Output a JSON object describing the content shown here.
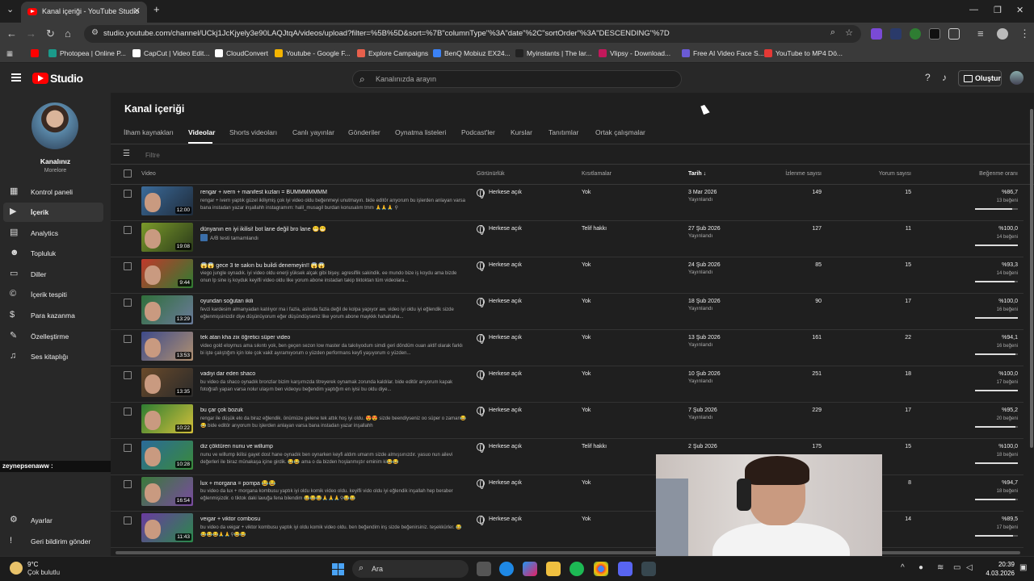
{
  "browser": {
    "tab_title": "Kanal içeriği - YouTube Studio",
    "url": "studio.youtube.com/channel/UCkj1JcKjyely3e90LAQJtqA/videos/upload?filter=%5B%5D&sort=%7B\"columnType\"%3A\"date\"%2C\"sortOrder\"%3A\"DESCENDING\"%7D",
    "bookmarks": [
      {
        "label": "",
        "color": "#ff0000"
      },
      {
        "label": "Photopea | Online P...",
        "color": "#1b9a8a"
      },
      {
        "label": "CapCut | Video Edit...",
        "color": "#ffffff"
      },
      {
        "label": "CloudConvert",
        "color": "#ffffff"
      },
      {
        "label": "Youtube - Google F...",
        "color": "#f4b400"
      },
      {
        "label": "Explore Campaigns",
        "color": "#e8604c"
      },
      {
        "label": "BenQ Mobiuz EX24...",
        "color": "#3b82f6"
      },
      {
        "label": "Myinstants | The lar...",
        "color": "#222222"
      },
      {
        "label": "Vlipsy - Download...",
        "color": "#c2185b"
      },
      {
        "label": "Free AI Video Face S...",
        "color": "#6b5bd6"
      },
      {
        "label": "YouTube to MP4 Dö...",
        "color": "#e53935"
      }
    ]
  },
  "header": {
    "logo": "Studio",
    "search_placeholder": "Kanalınızda arayın",
    "create_label": "Oluştur"
  },
  "sidebar": {
    "channel_name": "Kanalınız",
    "channel_sub": "Morelore",
    "items": [
      {
        "label": "Kontrol paneli",
        "icon": "▦"
      },
      {
        "label": "İçerik",
        "icon": "▶"
      },
      {
        "label": "Analytics",
        "icon": "▤"
      },
      {
        "label": "Topluluk",
        "icon": "☻"
      },
      {
        "label": "Diller",
        "icon": "▭"
      },
      {
        "label": "İçerik tespiti",
        "icon": "©"
      },
      {
        "label": "Para kazanma",
        "icon": "$"
      },
      {
        "label": "Özelleştirme",
        "icon": "✎"
      },
      {
        "label": "Ses kitaplığı",
        "icon": "♫"
      }
    ],
    "bottom": [
      {
        "label": "Ayarlar",
        "icon": "⚙"
      },
      {
        "label": "Geri bildirim gönder",
        "icon": "!"
      }
    ],
    "overlay_user": "zeynepsenaww :"
  },
  "main": {
    "title": "Kanal içeriği",
    "tabs": [
      "İlham kaynakları",
      "Videolar",
      "Shorts videoları",
      "Canlı yayınlar",
      "Gönderiler",
      "Oynatma listeleri",
      "Podcast'ler",
      "Kurslar",
      "Tanıtımlar",
      "Ortak çalışmalar"
    ],
    "filter_placeholder": "Filtre",
    "columns": {
      "video": "Video",
      "visibility": "Görünürlük",
      "restrictions": "Kısıtlamalar",
      "date": "Tarih",
      "views": "İzlenme sayısı",
      "comments": "Yorum sayısı",
      "likes": "Beğenme oranı"
    },
    "rows": [
      {
        "title": "rengar + ivern + manifest kızları = BUMMMMMMM",
        "desc": "rengar + ivern yaptık güzel ikiliymiş çok iyi video oldu beğenmeyi unutmayın. bide editör arıyorum bu işlerden anlayan varsa bana instadan yazar inşallahh instagramım: halil_musagil burdan konusalım tmm 🙏🙏🙏 ⚲",
        "duration": "12:00",
        "visibility": "Herkese açık",
        "restriction": "Yok",
        "date": "3 Mar 2026",
        "status": "Yayınlandı",
        "views": "149",
        "comments": "15",
        "like_pct": "%86,7",
        "like_count": "13 beğeni",
        "like_ratio": 0.867,
        "t1": "#3b6b9a",
        "t2": "#1f2b3a"
      },
      {
        "title": "dünyanın en iyi ikilisi! bot lane değil bro lane 😁😁",
        "desc": "",
        "sub": "A/B testi tamamlandı",
        "duration": "19:08",
        "visibility": "Herkese açık",
        "restriction": "Telif hakkı",
        "date": "27 Şub 2026",
        "status": "Yayınlandı",
        "views": "127",
        "comments": "11",
        "like_pct": "%100,0",
        "like_count": "14 beğeni",
        "like_ratio": 1.0,
        "t1": "#7b9a2a",
        "t2": "#2a3a1a"
      },
      {
        "title": "😱😱 gece 3 te sakın bu buildi denemeyin!! 😱😱",
        "desc": "viego jungle oynadık. iyi video oldu enerji yüksek alçak gibi bişey. agresiflik sakindik. ee mundo bize iş koydu ama bizde onun lp sine iş koyduk keyifli video oldu like yorum abone instadan takip tiktoktan tüm videolara...",
        "duration": "9:44",
        "visibility": "Herkese açık",
        "restriction": "Yok",
        "date": "24 Şub 2026",
        "status": "Yayınlandı",
        "views": "85",
        "comments": "15",
        "like_pct": "%93,3",
        "like_count": "14 beğeni",
        "like_ratio": 0.933,
        "t1": "#c0392b",
        "t2": "#2e7d32"
      },
      {
        "title": "oyundan soğutan ikili",
        "desc": "fevzi kardesim almanyadan katılıyor ma i fazla, aslında fazla değil de kolpa yapıyor aw. video iyi oldu iyi eğlendik sizde eğlenmişsinizdir diye düşünüyorum eğer düşündüyseniz like yorum abone maykkk hahahaha...",
        "duration": "13:29",
        "visibility": "Herkese açık",
        "restriction": "Yok",
        "date": "18 Şub 2026",
        "status": "Yayınlandı",
        "views": "90",
        "comments": "17",
        "like_pct": "%100,0",
        "like_count": "16 beğeni",
        "like_ratio": 1.0,
        "t1": "#2f6f3a",
        "t2": "#6a7a9a"
      },
      {
        "title": "tek atan kha zix öğretici süper video",
        "desc": "video gold eloymus ama sıkıntı yok, ben geçen sezon low master da takılıyodum simdi geri döndüm ouan aktif olarak farklı bi işte çalıştığım için lole çok vakit ayıramıyorum o yüzden performans keyfi yaşıyorum o yüzden...",
        "duration": "13:53",
        "visibility": "Herkese açık",
        "restriction": "Yok",
        "date": "13 Şub 2026",
        "status": "Yayınlandı",
        "views": "161",
        "comments": "22",
        "like_pct": "%94,1",
        "like_count": "16 beğeni",
        "like_ratio": 0.941,
        "t1": "#3d4a8a",
        "t2": "#b09070"
      },
      {
        "title": "vadiyi dar eden shaco",
        "desc": "bu video da shaco oynadık bronzlar bizim karşımızda titreyerek oynamak zorunda kaldılar. bide editör arıyorum kapak fotoğrafı yapan varsa nolur ulaşım ben videoyu beğendim yaptığım en iyisi bu oldu diye...",
        "duration": "13:35",
        "visibility": "Herkese açık",
        "restriction": "Yok",
        "date": "10 Şub 2026",
        "status": "Yayınlandı",
        "views": "251",
        "comments": "18",
        "like_pct": "%100,0",
        "like_count": "17 beğeni",
        "like_ratio": 1.0,
        "t1": "#6a4a2a",
        "t2": "#2a2a2a"
      },
      {
        "title": "bu çar çok bozuk",
        "desc": "rengar ile düşük elo da biraz eğlendik. önümüze gelene tek attık hoş iyi oldu. 😍😍 sizde beendiyseniz oo süper o zaman😂😂 bide editör arıyorum bu işlerden anlayan varsa bana instadan yazar inşallahh",
        "duration": "10:22",
        "visibility": "Herkese açık",
        "restriction": "Yok",
        "date": "7 Şub 2026",
        "status": "Yayınlandı",
        "views": "229",
        "comments": "17",
        "like_pct": "%95,2",
        "like_count": "20 beğeni",
        "like_ratio": 0.952,
        "t1": "#2e7d32",
        "t2": "#d4c03a"
      },
      {
        "title": "diz çöktüren nunu ve willump",
        "desc": "nunu ve willump ikilisi gayet dost hane oynadık ben oynarken keyfi aldım umarım sizde almışsınızdır. yasuo nun ailevi değerleri ile biraz münakaşa içine girdik. 😂😂 ama o da bizden hoşlanmıştır eminim ki😂😂",
        "duration": "10:28",
        "visibility": "Herkese açık",
        "restriction": "Telif hakkı",
        "date": "2 Şub 2026",
        "status": "",
        "views": "175",
        "comments": "15",
        "like_pct": "%100,0",
        "like_count": "18 beğeni",
        "like_ratio": 1.0,
        "t1": "#2a6a9a",
        "t2": "#3a8a3a"
      },
      {
        "title": "lux + morgana = pompa 😂😂",
        "desc": "bu video da lux + morgana kombusu yaptık iyi oldu komik video oldu. keyifli vido oldu iyi eğlendik inşallah hep beraber eğlenmişizdir. o tiktok daki lavuğa fena bilendim 😂😂😂🙏🙏🙏⚲😂😂",
        "duration": "16:54",
        "visibility": "Herkese açık",
        "restriction": "Yok",
        "date": "",
        "status": "",
        "views": "",
        "comments": "8",
        "like_pct": "%94,7",
        "like_count": "18 beğeni",
        "like_ratio": 0.947,
        "t1": "#3a7a3a",
        "t2": "#7a4aa0"
      },
      {
        "title": "veigar + viktor combosu",
        "desc": "bu video da veigar + viktor kombusu yaptık iyi oldu komik video oldu. ben beğendim inş sizde beğenirsiniz. teşekkürler. 😂😂😂😂🙏🙏⚲😂😂",
        "duration": "11:43",
        "visibility": "Herkese açık",
        "restriction": "Yok",
        "date": "",
        "status": "",
        "views": "",
        "comments": "14",
        "like_pct": "%89,5",
        "like_count": "17 beğeni",
        "like_ratio": 0.895,
        "t1": "#6a3aa0",
        "t2": "#2a8a4a"
      }
    ]
  },
  "taskbar": {
    "temp": "9°C",
    "weather": "Çok bulutlu",
    "search_label": "Ara",
    "time": "20:39",
    "date": "4.03.2026"
  }
}
